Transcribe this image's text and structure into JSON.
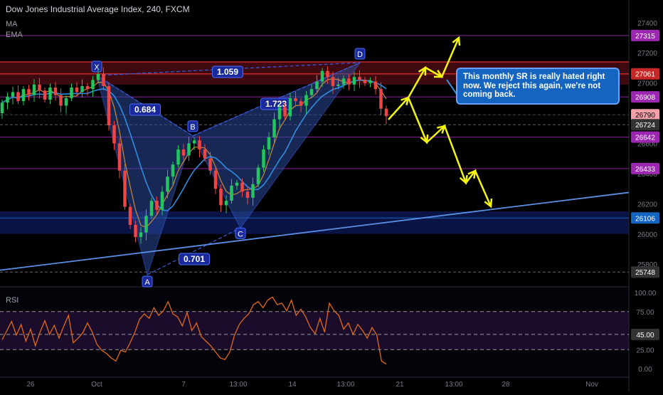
{
  "header": {
    "title": "Dow Jones Industrial Average Index, 240, FXCM",
    "indicators": [
      "MA",
      "EMA"
    ]
  },
  "colors": {
    "background": "#000000",
    "bull": "#22c55e",
    "bear": "#ef4444",
    "pattern_fill": "#2a4a9a",
    "pattern_line": "#3b5bdb",
    "trendline": "#5b8fe6",
    "arrow": "#f5f514",
    "rsi_line": "#e06a1a",
    "level_purple": "#9c27b0",
    "level_blue": "#1565c0",
    "level_red": "#c62828",
    "level_gray": "#333333"
  },
  "chart_data": [
    {
      "type": "candlestick",
      "title": "Dow Jones Industrial Average Index, 240, FXCM",
      "x_ticks": [
        "26",
        "Oct",
        "7",
        "13:00",
        "14",
        "13:00",
        "21",
        "13:00",
        "28",
        "Nov"
      ],
      "y_ticks": [
        27400,
        27200,
        27000,
        26800,
        26600,
        26400,
        26200,
        26000,
        25800
      ],
      "ylim": [
        25650,
        27550
      ],
      "price_labels": [
        {
          "value": 27315,
          "style": "purple"
        },
        {
          "value": 27061,
          "style": "red"
        },
        {
          "value": 26908,
          "style": "purple"
        },
        {
          "value": 26790,
          "style": "pink"
        },
        {
          "value": 26724,
          "style": "gray"
        },
        {
          "value": 26642,
          "style": "purple"
        },
        {
          "value": 26433,
          "style": "purple"
        },
        {
          "value": 26106,
          "style": "blue"
        },
        {
          "value": 25748,
          "style": "gray"
        }
      ],
      "pattern_points": [
        {
          "name": "X",
          "value": 27050
        },
        {
          "name": "A",
          "value": 25730
        },
        {
          "name": "B",
          "value": 26650
        },
        {
          "name": "C",
          "value": 26040
        },
        {
          "name": "D",
          "value": 27135
        }
      ],
      "ratios": [
        "1.059",
        "0.684",
        "1.723",
        "0.701"
      ],
      "annotation": "This monthly SR is really hated right now. We reject this again, we're not coming back.",
      "close_series": [
        26870,
        26910,
        26940,
        26880,
        26960,
        26920,
        26990,
        26950,
        26890,
        26970,
        26920,
        26850,
        26900,
        26970,
        26940,
        26980,
        26960,
        27020,
        27060,
        26980,
        26720,
        26600,
        26420,
        26180,
        26060,
        25980,
        26010,
        26120,
        26220,
        26160,
        26280,
        26380,
        26460,
        26560,
        26520,
        26600,
        26620,
        26560,
        26500,
        26420,
        26300,
        26190,
        26220,
        26320,
        26340,
        26280,
        26240,
        26330,
        26440,
        26560,
        26640,
        26760,
        26840,
        26780,
        26900,
        26880,
        26850,
        26920,
        26960,
        27010,
        27080,
        27040,
        26980,
        26990,
        27030,
        26990,
        27040,
        27020,
        27000,
        27010,
        26960,
        26830,
        26780
      ],
      "open_series": [
        26800,
        26870,
        26910,
        26940,
        26880,
        26960,
        26920,
        26990,
        26950,
        26890,
        26970,
        26920,
        26850,
        26900,
        26970,
        26940,
        26980,
        26960,
        27020,
        27060,
        26980,
        26720,
        26600,
        26420,
        26180,
        26060,
        25980,
        26010,
        26120,
        26220,
        26160,
        26280,
        26380,
        26460,
        26560,
        26520,
        26600,
        26620,
        26560,
        26500,
        26420,
        26300,
        26190,
        26220,
        26320,
        26340,
        26280,
        26240,
        26330,
        26440,
        26560,
        26640,
        26760,
        26840,
        26780,
        26900,
        26880,
        26850,
        26920,
        26960,
        27010,
        27080,
        27040,
        26980,
        26990,
        27030,
        26990,
        27040,
        27020,
        27000,
        27010,
        26960,
        26830
      ]
    },
    {
      "type": "line",
      "title": "RSI",
      "y_ticks": [
        "100.00",
        "75.00",
        "45.00",
        "25.00",
        "0.00"
      ],
      "ylim": [
        0,
        100
      ],
      "values": [
        38,
        50,
        62,
        44,
        58,
        36,
        52,
        30,
        48,
        63,
        45,
        57,
        40,
        56,
        70,
        34,
        40,
        47,
        60,
        48,
        32,
        24,
        20,
        14,
        10,
        24,
        22,
        34,
        48,
        65,
        72,
        66,
        80,
        70,
        76,
        88,
        72,
        68,
        56,
        74,
        50,
        60,
        42,
        36,
        30,
        22,
        14,
        12,
        22,
        44,
        58,
        66,
        72,
        84,
        88,
        80,
        90,
        94,
        84,
        86,
        76,
        90,
        70,
        78,
        68,
        54,
        46,
        66,
        48,
        86,
        76,
        70,
        52,
        60,
        45,
        58,
        50,
        40,
        54,
        44,
        10,
        6
      ]
    }
  ]
}
